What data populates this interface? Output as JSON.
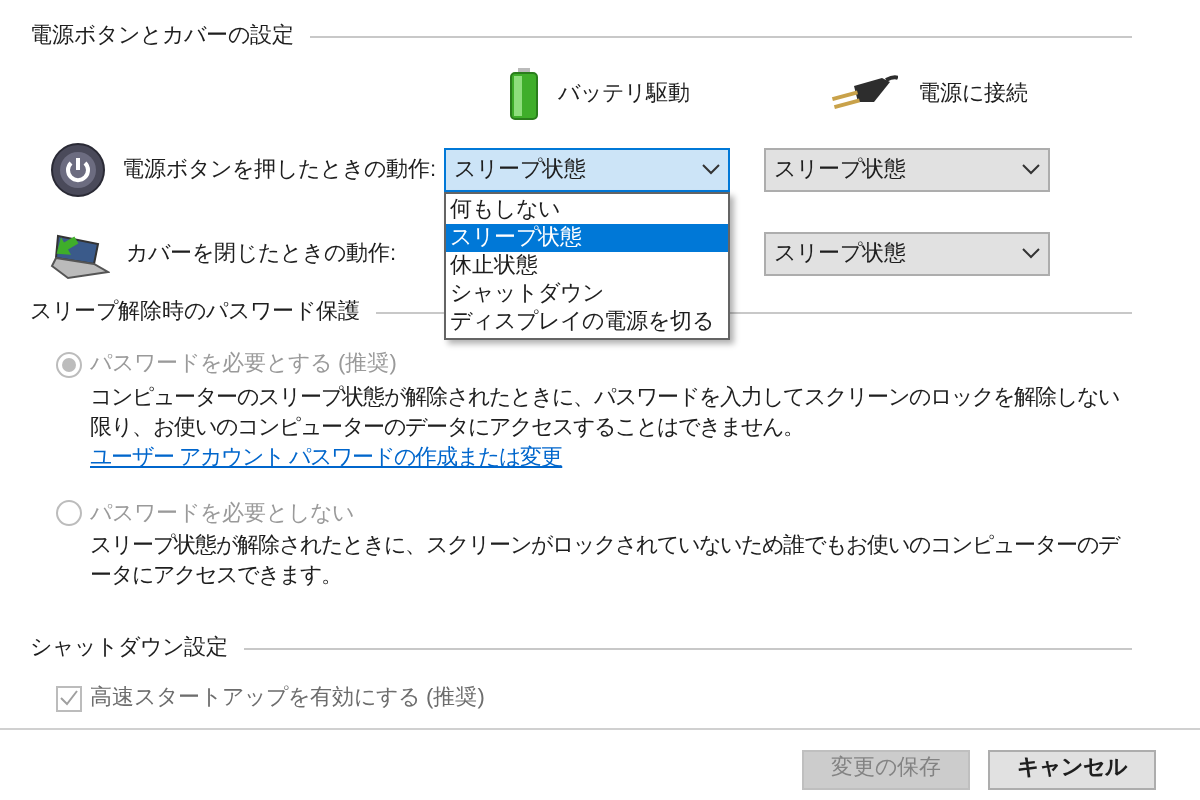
{
  "power_section": {
    "title": "電源ボタンとカバーの設定",
    "columns": [
      {
        "label": "バッテリ駆動",
        "kind": "battery"
      },
      {
        "label": "電源に接続",
        "kind": "plug"
      }
    ],
    "rows": [
      {
        "label": "電源ボタンを押したときの動作:",
        "kind": "power",
        "battery": {
          "value": "スリープ状態",
          "open": true
        },
        "plugged": {
          "value": "スリープ状態",
          "open": false
        }
      },
      {
        "label": "カバーを閉じたときの動作:",
        "kind": "lid",
        "plugged": {
          "value": "スリープ状態",
          "open": false
        }
      }
    ],
    "open_menu": [
      {
        "label": "何もしない",
        "selected": false
      },
      {
        "label": "スリープ状態",
        "selected": true
      },
      {
        "label": "休止状態",
        "selected": false
      },
      {
        "label": "シャットダウン",
        "selected": false
      },
      {
        "label": "ディスプレイの電源を切る",
        "selected": false
      }
    ]
  },
  "password_section": {
    "title": "スリープ解除時のパスワード保護",
    "options": [
      {
        "label": "パスワードを必要とする (推奨)",
        "selected": true,
        "disabled": true,
        "description": "コンピューターのスリープ状態が解除されたときに、パスワードを入力してスクリーンのロックを解除しない限り、お使いのコンピューターのデータにアクセスすることはできません。",
        "link": "ユーザー アカウント パスワードの作成または変更"
      },
      {
        "label": "パスワードを必要としない",
        "selected": false,
        "disabled": true,
        "description": "スリープ状態が解除されたときに、スクリーンがロックされていないため誰でもお使いのコンピューターのデータにアクセスできます。"
      }
    ]
  },
  "shutdown_section": {
    "title": "シャットダウン設定",
    "checkboxes": [
      {
        "label": "高速スタートアップを有効にする (推奨)",
        "checked": true,
        "disabled": true
      }
    ]
  },
  "buttons": [
    {
      "label": "変更の保存",
      "disabled": true
    },
    {
      "label": "キャンセル",
      "disabled": false
    }
  ]
}
